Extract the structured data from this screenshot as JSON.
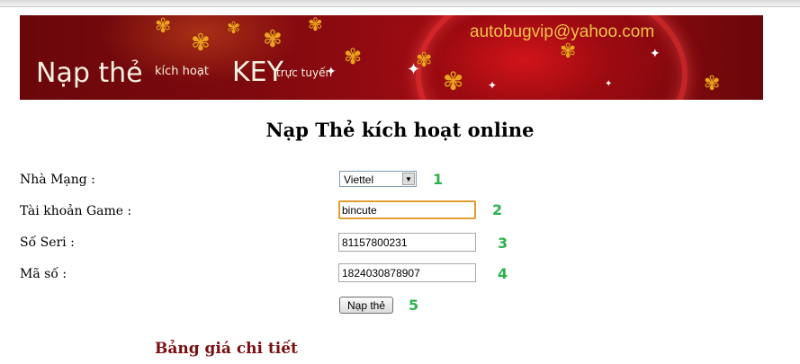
{
  "banner": {
    "email": "autobugvip@yahoo.com",
    "title_main": "Nạp thẻ",
    "title_small": "kích hoạt",
    "title_key": "KEY",
    "title_online": "trực tuyến"
  },
  "form": {
    "heading": "Nạp Thẻ kích hoạt online",
    "network_label": "Nhà Mạng :",
    "network_value": "Viettel",
    "account_label": "Tài khoản Game :",
    "account_value": "bincute",
    "serial_label": "Số Seri :",
    "serial_value": "81157800231",
    "code_label": "Mã số :",
    "code_value": "1824030878907",
    "submit_label": "Nạp thẻ",
    "step_numbers": [
      "1",
      "2",
      "3",
      "4",
      "5"
    ]
  },
  "price_table_title": "Bảng giá chi tiết",
  "colors": {
    "banner_red": "#8c0a0f",
    "step_green": "#2bb24c",
    "price_title": "#7a0f12",
    "focus_border": "#e0a030"
  }
}
